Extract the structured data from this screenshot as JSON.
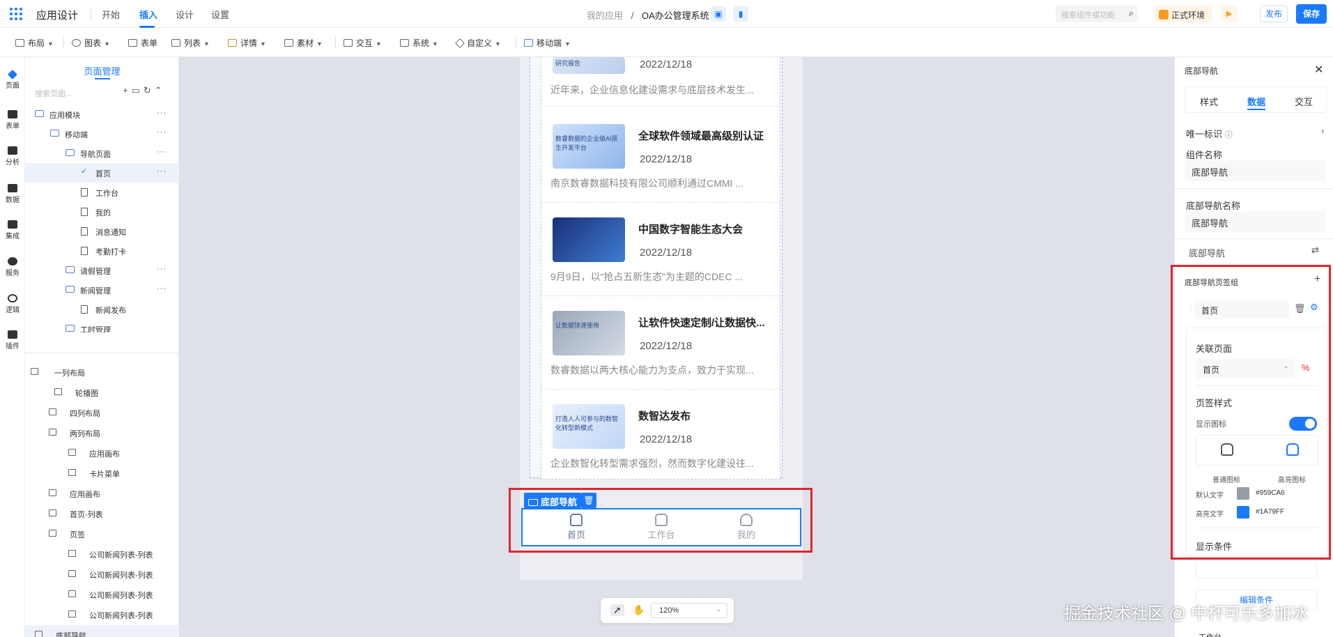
{
  "header": {
    "app_title": "应用设计",
    "tabs": [
      "开始",
      "插入",
      "设计",
      "设置"
    ],
    "active_tab": "插入",
    "breadcrumb_parent": "我的应用",
    "breadcrumb_sep": "/",
    "breadcrumb_current": "OA办公管理系统",
    "search_placeholder": "搜索组件或功能",
    "env_label": "正式环境",
    "publish_label": "发布",
    "save_label": "保存"
  },
  "toolbar": {
    "items": [
      "布局",
      "图表",
      "表单",
      "列表",
      "详情",
      "素材",
      "交互",
      "系统",
      "自定义",
      "移动端"
    ]
  },
  "rail": {
    "items": [
      "页面",
      "表单",
      "分析",
      "数据",
      "集成",
      "服务",
      "逻辑",
      "插件"
    ]
  },
  "page_panel": {
    "title": "页面管理",
    "search_placeholder": "搜索页面...",
    "tree": [
      {
        "label": "应用模块",
        "type": "folder",
        "more": "···"
      },
      {
        "label": "移动端",
        "type": "folder",
        "more": "···"
      },
      {
        "label": "导航页面",
        "type": "folder",
        "more": "···"
      },
      {
        "label": "首页",
        "type": "check",
        "more": "···"
      },
      {
        "label": "工作台",
        "type": "page"
      },
      {
        "label": "我的",
        "type": "page"
      },
      {
        "label": "消息通知",
        "type": "page"
      },
      {
        "label": "考勤打卡",
        "type": "page"
      },
      {
        "label": "请假管理",
        "type": "folder",
        "more": "···"
      },
      {
        "label": "新闻管理",
        "type": "folder",
        "more": "···"
      },
      {
        "label": "新闻发布",
        "type": "page"
      },
      {
        "label": "工时管理",
        "type": "folder"
      }
    ],
    "outline": [
      "一列布局",
      "轮播图",
      "四列布局",
      "两列布局",
      "应用画布",
      "卡片菜单",
      "应用画布",
      "首页-列表",
      "页签",
      "公司新闻列表-列表",
      "公司新闻列表-列表",
      "公司新闻列表-列表",
      "公司新闻列表-列表",
      "底部导航"
    ]
  },
  "canvas": {
    "news": [
      {
        "title": "",
        "date": "2022/12/18",
        "desc": "近年来，企业信息化建设需求与底层技术发生...",
        "thumb_text": "研究报告"
      },
      {
        "title": "全球软件领域最高级别认证",
        "date": "2022/12/18",
        "desc": "南京数睿数据科技有限公司顺利通过CMMI ...",
        "thumb_text": "数睿数据的企业级AI原生开发平台"
      },
      {
        "title": "中国数字智能生态大会",
        "date": "2022/12/18",
        "desc": "9月9日，以“抢占五新生态”为主题的CDEC ...",
        "thumb_text": ""
      },
      {
        "title": "让软件快速定制/让数据快...",
        "date": "2022/12/18",
        "desc": "数睿数据以两大核心能力为支点，致力于实现...",
        "thumb_text": "让数据快速使用"
      },
      {
        "title": "数智达发布",
        "date": "2022/12/18",
        "desc": "企业数智化转型需求强烈，然而数字化建设往...",
        "thumb_text": "打造人人可参与的数智化转型新模式"
      }
    ],
    "bottom_nav_tag": "底部导航",
    "bottom_nav": [
      {
        "label": "首页",
        "color": "#959CA6"
      },
      {
        "label": "工作台",
        "color": "#959CA6"
      },
      {
        "label": "我的",
        "color": "#959CA6"
      }
    ],
    "zoom": "120%"
  },
  "props": {
    "title": "底部导航",
    "tabs": [
      "样式",
      "数据",
      "交互"
    ],
    "active_tab": "数据",
    "unique_id_label": "唯一标识",
    "component_name_label": "组件名称",
    "component_name_value": "底部导航",
    "nav_name_label": "底部导航名称",
    "nav_name_value": "底部导航",
    "nav_section_label": "底部导航",
    "tab_group_label": "底部导航页签组",
    "tab_item_value": "首页",
    "linked_page_label": "关联页面",
    "linked_page_value": "首页",
    "tab_style_label": "页签样式",
    "show_icon_label": "显示图标",
    "show_icon_on": true,
    "normal_icon_label": "普通图标",
    "highlight_icon_label": "高亮图标",
    "default_text_label": "默认文字",
    "default_text_color": "#959CA6",
    "highlight_text_label": "高亮文字",
    "highlight_text_color": "#1A79FF",
    "display_condition_label": "显示条件",
    "edit_condition_label": "编辑条件",
    "next_tab_value": "工作台"
  },
  "watermark": "掘金技术社区 @ 中杯可乐多加冰"
}
